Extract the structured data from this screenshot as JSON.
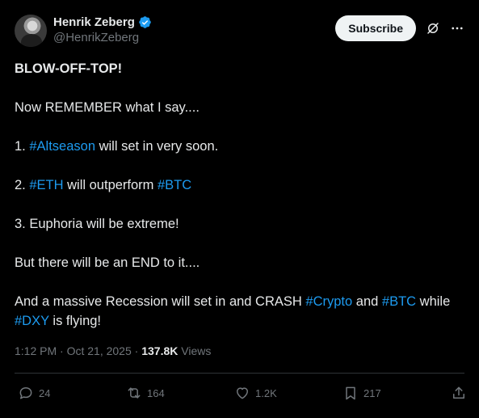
{
  "author": {
    "display_name": "Henrik Zeberg",
    "handle": "@HenrikZeberg",
    "verified": true
  },
  "header": {
    "subscribe_label": "Subscribe",
    "icons": [
      "grok-icon",
      "more-icon"
    ]
  },
  "post": {
    "line1": "BLOW-OFF-TOP!",
    "line2": "Now REMEMBER what I say....",
    "item1": {
      "prefix": "1. ",
      "tag": "#Altseason",
      "suffix": " will set in very soon."
    },
    "item2": {
      "prefix": "2. ",
      "tag1": "#ETH",
      "middle": " will outperform ",
      "tag2": "#BTC"
    },
    "item3": "3. Euphoria will be extreme!",
    "line_end": "But there will be an END to it....",
    "closing": {
      "part1": "And a massive Recession will set in and CRASH ",
      "tag1": "#Crypto",
      "part2": " and ",
      "tag2": "#BTC",
      "part3": " while ",
      "tag3": "#DXY",
      "part4": " is flying!"
    }
  },
  "meta": {
    "time": "1:12 PM",
    "separator1": " · ",
    "date": "Oct 21, 2025",
    "separator2": " · ",
    "views_count": "137.8K",
    "views_label": " Views"
  },
  "actions": {
    "replies": "24",
    "reposts": "164",
    "likes": "1.2K",
    "bookmarks": "217"
  },
  "colors": {
    "background": "#000000",
    "text": "#e7e9ea",
    "secondary": "#71767b",
    "link": "#1d9bf0",
    "verified": "#1d9bf0"
  }
}
